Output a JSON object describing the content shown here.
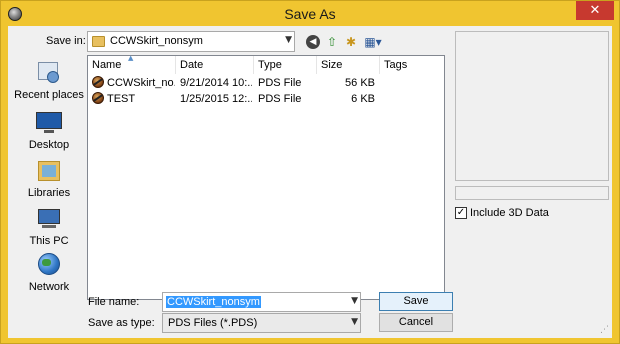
{
  "window": {
    "title": "Save As",
    "close_glyph": "✕"
  },
  "toolbar": {
    "save_in_label": "Save in:",
    "save_in_value": "CCWSkirt_nonsym",
    "icons": [
      "back-icon",
      "up-folder-icon",
      "new-folder-icon",
      "view-menu-icon"
    ]
  },
  "places": [
    {
      "label": "Recent places",
      "icon": "recent-places-icon"
    },
    {
      "label": "Desktop",
      "icon": "desktop-icon"
    },
    {
      "label": "Libraries",
      "icon": "libraries-icon"
    },
    {
      "label": "This PC",
      "icon": "this-pc-icon"
    },
    {
      "label": "Network",
      "icon": "network-icon"
    }
  ],
  "columns": [
    "Name",
    "Date",
    "Type",
    "Size",
    "Tags"
  ],
  "files": [
    {
      "name": "CCWSkirt_no...",
      "date": "9/21/2014 10:...",
      "type": "PDS File",
      "size": "56 KB"
    },
    {
      "name": "TEST",
      "date": "1/25/2015 12:...",
      "type": "PDS File",
      "size": "6 KB"
    }
  ],
  "form": {
    "file_name_label": "File name:",
    "file_name_value": "CCWSkirt_nonsym",
    "save_as_type_label": "Save as type:",
    "save_as_type_value": "PDS Files (*.PDS)",
    "save_label": "Save",
    "cancel_label": "Cancel"
  },
  "options": {
    "include_3d_label": "Include 3D Data",
    "include_3d_checked": true
  },
  "colors": {
    "title_bar": "#f0c530",
    "close_button": "#c7392f",
    "selection": "#3399ff"
  }
}
